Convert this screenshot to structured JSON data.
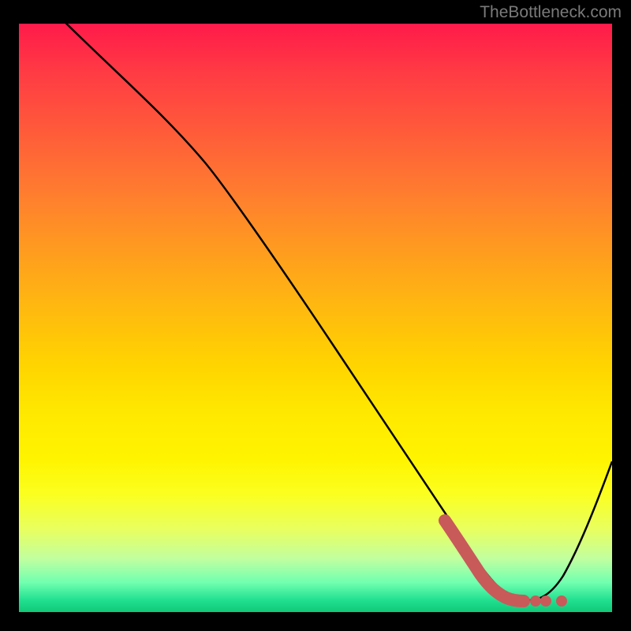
{
  "watermark": "TheBottleneck.com",
  "chart_data": {
    "type": "line",
    "title": "",
    "xlabel": "",
    "ylabel": "",
    "xlim": [
      0,
      100
    ],
    "ylim": [
      0,
      100
    ],
    "grid": false,
    "legend": false,
    "series": [
      {
        "name": "bottleneck-curve",
        "color": "#000000",
        "x": [
          0,
          8,
          18,
          30,
          40,
          50,
          60,
          70,
          78,
          82,
          86,
          92,
          100
        ],
        "y": [
          100,
          88,
          76,
          62,
          48,
          34,
          20,
          8,
          2,
          1,
          2,
          10,
          30
        ]
      },
      {
        "name": "optimum-zone",
        "type": "scatter",
        "color": "#c85a5a",
        "x": [
          62,
          64,
          66,
          68,
          70,
          72,
          74,
          76,
          78,
          80,
          82,
          84,
          86
        ],
        "y": [
          18,
          15,
          12,
          9,
          6,
          4,
          3,
          2,
          2,
          2,
          2,
          2,
          2
        ]
      }
    ],
    "background": "heat-gradient"
  }
}
